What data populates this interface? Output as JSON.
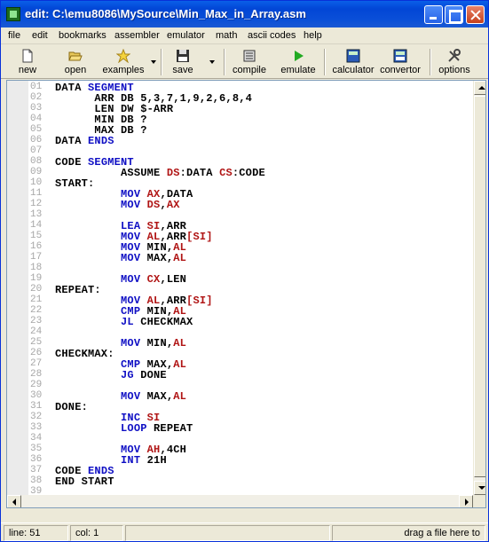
{
  "window": {
    "title": "edit: C:\\emu8086\\MySource\\Min_Max_in_Array.asm"
  },
  "menu": [
    "file",
    "edit",
    "bookmarks",
    "assembler",
    "emulator",
    "math",
    "ascii codes",
    "help"
  ],
  "toolbar": {
    "new": "new",
    "open": "open",
    "examples": "examples",
    "save": "save",
    "compile": "compile",
    "emulate": "emulate",
    "calculator": "calculator",
    "convertor": "convertor",
    "options": "options"
  },
  "code_lines": [
    {
      "n": "01",
      "t": [
        [
          "",
          "DATA "
        ],
        [
          "k",
          "SEGMENT"
        ]
      ]
    },
    {
      "n": "02",
      "t": [
        [
          "",
          "      ARR DB 5,3,7,1,9,2,6,8,4"
        ]
      ]
    },
    {
      "n": "03",
      "t": [
        [
          "",
          "      LEN DW $-ARR"
        ]
      ]
    },
    {
      "n": "04",
      "t": [
        [
          "",
          "      MIN DB ?"
        ]
      ]
    },
    {
      "n": "05",
      "t": [
        [
          "",
          "      MAX DB ?"
        ]
      ]
    },
    {
      "n": "06",
      "t": [
        [
          "",
          "DATA "
        ],
        [
          "k",
          "ENDS"
        ]
      ]
    },
    {
      "n": "07",
      "t": []
    },
    {
      "n": "08",
      "t": [
        [
          "",
          "CODE "
        ],
        [
          "k",
          "SEGMENT"
        ]
      ]
    },
    {
      "n": "09",
      "t": [
        [
          "",
          "          ASSUME "
        ],
        [
          "r",
          "DS"
        ],
        [
          "",
          ":DATA "
        ],
        [
          "r",
          "CS"
        ],
        [
          "",
          ":CODE"
        ]
      ]
    },
    {
      "n": "10",
      "t": [
        [
          "",
          "START:"
        ]
      ]
    },
    {
      "n": "11",
      "t": [
        [
          "",
          "          "
        ],
        [
          "k",
          "MOV"
        ],
        [
          "",
          " "
        ],
        [
          "r",
          "AX"
        ],
        [
          "",
          ",DATA"
        ]
      ]
    },
    {
      "n": "12",
      "t": [
        [
          "",
          "          "
        ],
        [
          "k",
          "MOV"
        ],
        [
          "",
          " "
        ],
        [
          "r",
          "DS"
        ],
        [
          "",
          ","
        ],
        [
          "r",
          "AX"
        ]
      ]
    },
    {
      "n": "13",
      "t": []
    },
    {
      "n": "14",
      "t": [
        [
          "",
          "          "
        ],
        [
          "k",
          "LEA"
        ],
        [
          "",
          " "
        ],
        [
          "r",
          "SI"
        ],
        [
          "",
          ",ARR"
        ]
      ]
    },
    {
      "n": "15",
      "t": [
        [
          "",
          "          "
        ],
        [
          "k",
          "MOV"
        ],
        [
          "",
          " "
        ],
        [
          "r",
          "AL"
        ],
        [
          "",
          ",ARR"
        ],
        [
          "b",
          "[SI]"
        ]
      ]
    },
    {
      "n": "16",
      "t": [
        [
          "",
          "          "
        ],
        [
          "k",
          "MOV"
        ],
        [
          "",
          " MIN,"
        ],
        [
          "r",
          "AL"
        ]
      ]
    },
    {
      "n": "17",
      "t": [
        [
          "",
          "          "
        ],
        [
          "k",
          "MOV"
        ],
        [
          "",
          " MAX,"
        ],
        [
          "r",
          "AL"
        ]
      ]
    },
    {
      "n": "18",
      "t": []
    },
    {
      "n": "19",
      "t": [
        [
          "",
          "          "
        ],
        [
          "k",
          "MOV"
        ],
        [
          "",
          " "
        ],
        [
          "r",
          "CX"
        ],
        [
          "",
          ",LEN"
        ]
      ]
    },
    {
      "n": "20",
      "t": [
        [
          "",
          "REPEAT:"
        ]
      ]
    },
    {
      "n": "21",
      "t": [
        [
          "",
          "          "
        ],
        [
          "k",
          "MOV"
        ],
        [
          "",
          " "
        ],
        [
          "r",
          "AL"
        ],
        [
          "",
          ",ARR"
        ],
        [
          "b",
          "[SI]"
        ]
      ]
    },
    {
      "n": "22",
      "t": [
        [
          "",
          "          "
        ],
        [
          "k",
          "CMP"
        ],
        [
          "",
          " MIN,"
        ],
        [
          "r",
          "AL"
        ]
      ]
    },
    {
      "n": "23",
      "t": [
        [
          "",
          "          "
        ],
        [
          "k",
          "JL"
        ],
        [
          "",
          " CHECKMAX"
        ]
      ]
    },
    {
      "n": "24",
      "t": []
    },
    {
      "n": "25",
      "t": [
        [
          "",
          "          "
        ],
        [
          "k",
          "MOV"
        ],
        [
          "",
          " MIN,"
        ],
        [
          "r",
          "AL"
        ]
      ]
    },
    {
      "n": "26",
      "t": [
        [
          "",
          "CHECKMAX:"
        ]
      ]
    },
    {
      "n": "27",
      "t": [
        [
          "",
          "          "
        ],
        [
          "k",
          "CMP"
        ],
        [
          "",
          " MAX,"
        ],
        [
          "r",
          "AL"
        ]
      ]
    },
    {
      "n": "28",
      "t": [
        [
          "",
          "          "
        ],
        [
          "k",
          "JG"
        ],
        [
          "",
          " DONE"
        ]
      ]
    },
    {
      "n": "29",
      "t": []
    },
    {
      "n": "30",
      "t": [
        [
          "",
          "          "
        ],
        [
          "k",
          "MOV"
        ],
        [
          "",
          " MAX,"
        ],
        [
          "r",
          "AL"
        ]
      ]
    },
    {
      "n": "31",
      "t": [
        [
          "",
          "DONE:"
        ]
      ]
    },
    {
      "n": "32",
      "t": [
        [
          "",
          "          "
        ],
        [
          "k",
          "INC"
        ],
        [
          "",
          " "
        ],
        [
          "r",
          "SI"
        ]
      ]
    },
    {
      "n": "33",
      "t": [
        [
          "",
          "          "
        ],
        [
          "k",
          "LOOP"
        ],
        [
          "",
          " REPEAT"
        ]
      ]
    },
    {
      "n": "34",
      "t": []
    },
    {
      "n": "35",
      "t": [
        [
          "",
          "          "
        ],
        [
          "k",
          "MOV"
        ],
        [
          "",
          " "
        ],
        [
          "r",
          "AH"
        ],
        [
          "",
          ",4CH"
        ]
      ]
    },
    {
      "n": "36",
      "t": [
        [
          "",
          "          "
        ],
        [
          "k",
          "INT"
        ],
        [
          "",
          " 21H"
        ]
      ]
    },
    {
      "n": "37",
      "t": [
        [
          "",
          "CODE "
        ],
        [
          "k",
          "ENDS"
        ]
      ]
    },
    {
      "n": "38",
      "t": [
        [
          "",
          "END START"
        ]
      ]
    },
    {
      "n": "39",
      "t": []
    }
  ],
  "status": {
    "line": "line: 51",
    "col": "col: 1",
    "hint": "drag a file here to"
  },
  "colors": {
    "keyword": "#0f0fc4",
    "register": "#b01414",
    "title_bar": "#0a4fd8"
  }
}
